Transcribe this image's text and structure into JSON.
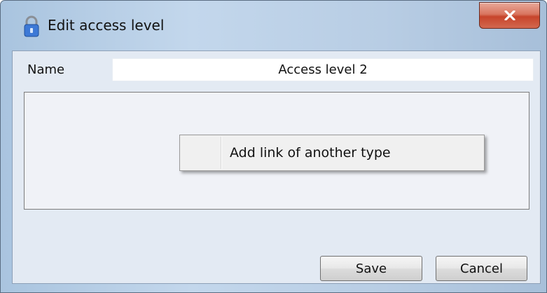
{
  "window": {
    "title": "Edit access level",
    "title_icon": "lock-icon",
    "close_icon": "close-icon"
  },
  "form": {
    "name_label": "Name",
    "name_value": "Access level 2"
  },
  "context_menu": {
    "items": [
      {
        "label": "Add link of another type"
      }
    ]
  },
  "buttons": {
    "save_label": "Save",
    "cancel_label": "Cancel"
  },
  "colors": {
    "titlebar": "#b8cde4",
    "close_button": "#c7452b",
    "client_background": "#e3eaf3",
    "lock_icon": "#3d79d6"
  }
}
